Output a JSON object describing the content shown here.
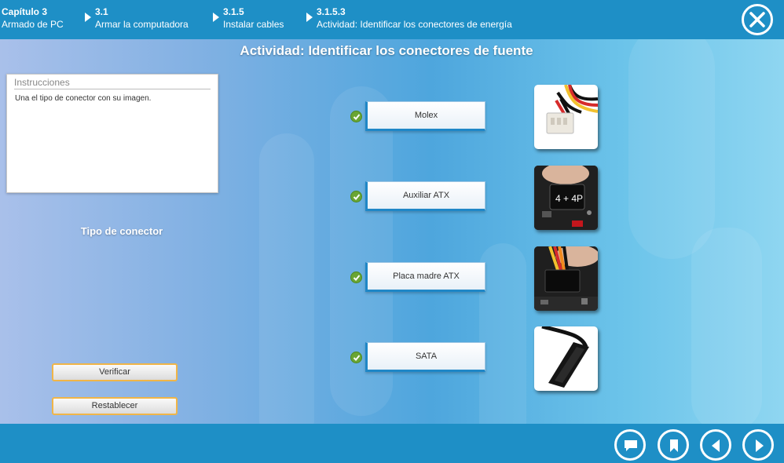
{
  "header": {
    "breadcrumbs": [
      {
        "num": "Capítulo 3",
        "label": "Armado de PC"
      },
      {
        "num": "3.1",
        "label": "Armar la computadora"
      },
      {
        "num": "3.1.5",
        "label": "Instalar cables"
      },
      {
        "num": "3.1.5.3",
        "label": "Actividad: Identificar los conectores de energía"
      }
    ],
    "close_icon": "close-icon"
  },
  "main": {
    "title": "Actividad: Identificar los conectores de fuente",
    "instructions": {
      "heading": "Instrucciones",
      "text": "Una el tipo de conector con su imagen."
    },
    "type_label": "Tipo de conector",
    "verify_label": "Verificar",
    "reset_label": "Restablecer",
    "connectors": [
      {
        "label": "Molex",
        "correct": true,
        "image_icon": "molex-connector-image"
      },
      {
        "label": "Auxiliar ATX",
        "correct": true,
        "image_icon": "aux-atx-connector-image"
      },
      {
        "label": "Placa madre ATX",
        "correct": true,
        "image_icon": "motherboard-atx-connector-image"
      },
      {
        "label": "SATA",
        "correct": true,
        "image_icon": "sata-connector-image"
      }
    ],
    "connector_image_text": "4 + 4P"
  },
  "footer": {
    "buttons": [
      "comment-icon",
      "bookmark-icon",
      "previous-icon",
      "next-icon"
    ]
  },
  "colors": {
    "bar": "#1e8fc6",
    "check": "#6aa533",
    "button_border": "#f0b548"
  }
}
